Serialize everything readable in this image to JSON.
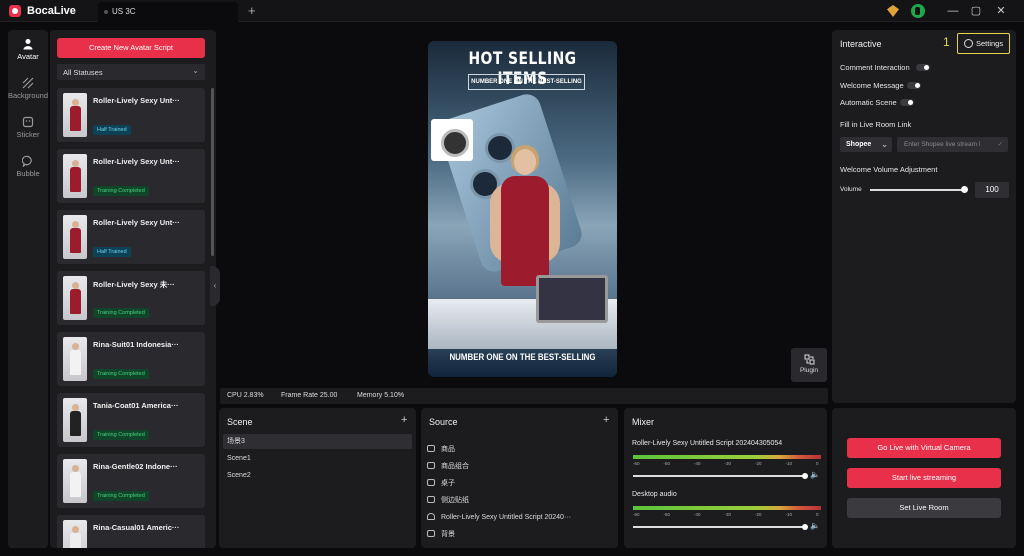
{
  "app": {
    "title": "BocaLive",
    "tab_label": "US 3C",
    "add_tab": "+"
  },
  "window": {
    "minimize": "—",
    "maximize": "▢",
    "close": "✕"
  },
  "nav": [
    {
      "label": "Avatar",
      "icon": "avatar-icon"
    },
    {
      "label": "Background",
      "icon": "background-icon"
    },
    {
      "label": "Sticker",
      "icon": "sticker-icon"
    },
    {
      "label": "Bubble",
      "icon": "bubble-icon"
    }
  ],
  "scripts": {
    "create_label": "Create New Avatar Script",
    "status_filter": "All Statuses",
    "items": [
      {
        "title": "Roller-Lively Sexy Unt···",
        "status": "Half Trained",
        "dress": "#9c1b2c"
      },
      {
        "title": "Roller-Lively Sexy Unt···",
        "status": "Training Completed",
        "dress": "#9c1b2c"
      },
      {
        "title": "Roller-Lively Sexy Unt···",
        "status": "Half Trained",
        "dress": "#9c1b2c"
      },
      {
        "title": "Roller-Lively Sexy 未···",
        "status": "Training Completed",
        "dress": "#9c1b2c"
      },
      {
        "title": "Rina-Suit01 Indonesia···",
        "status": "Training Completed",
        "dress": "#f2f2f2"
      },
      {
        "title": "Tania-Coat01 America···",
        "status": "Training Completed",
        "dress": "#222222"
      },
      {
        "title": "Rina-Gentle02 Indone···",
        "status": "Training Completed",
        "dress": "#f2f2f2"
      },
      {
        "title": "Rina-Casual01 Americ···",
        "status": "Training Completed",
        "dress": "#eeeeee"
      }
    ]
  },
  "preview": {
    "headline": "HOT SELLING ITEMS",
    "subheadline": "NUMBER ONE ON THE BEST-SELLING",
    "footer_text": "NUMBER ONE ON THE BEST-SELLING",
    "plugin_label": "Plugin"
  },
  "stats": {
    "cpu": "CPU 2.83%",
    "frame_rate": "Frame Rate 25.00",
    "memory": "Memory 5.10%"
  },
  "scene": {
    "title": "Scene",
    "add": "+",
    "items": [
      "场景3",
      "Scene1",
      "Scene2"
    ],
    "selected": 0
  },
  "source": {
    "title": "Source",
    "add": "+",
    "items": [
      "商品",
      "商品组合",
      "桌子",
      "侧边贴纸",
      "Roller-Lively Sexy Untitled Script 20240···",
      "背景"
    ],
    "icon_types": [
      "image",
      "image",
      "image",
      "image",
      "person",
      "image"
    ]
  },
  "mixer": {
    "title": "Mixer",
    "ticks": [
      "-60",
      "-50",
      "-40",
      "-30",
      "-20",
      "-10",
      "0"
    ],
    "channels": [
      {
        "name": "Roller-Lively Sexy Untitled Script 202404305054",
        "volume": 1.0
      },
      {
        "name": "Desktop audio",
        "volume": 1.0
      }
    ]
  },
  "interactive": {
    "title": "Interactive",
    "marker": "1",
    "settings_label": "Settings",
    "comment_label": "Comment Interaction",
    "comment_on": false,
    "welcome_label": "Welcome Message",
    "welcome_on": false,
    "auto_scene_label": "Automatic Scene",
    "auto_scene_on": false,
    "link_heading": "Fill in Live Room Link",
    "platform": "Shopee",
    "link_placeholder": "Enter Shopee live stream l",
    "volume_heading": "Welcome Volume Adjustment",
    "volume_label": "Volume",
    "volume_value": "100"
  },
  "live": {
    "virtual_cam": "Go Live with Virtual Camera",
    "start_stream": "Start live streaming",
    "set_room": "Set Live Room"
  },
  "colors": {
    "accent": "#e8304a",
    "half_trained": "#6fd0ef",
    "completed": "#43d37c",
    "highlight": "#e6d44a"
  }
}
